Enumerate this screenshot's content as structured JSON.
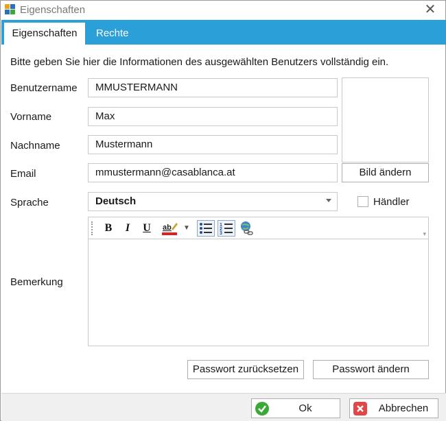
{
  "window": {
    "title": "Eigenschaften",
    "close_glyph": "✕"
  },
  "tabs": [
    {
      "label": "Eigenschaften",
      "active": true
    },
    {
      "label": "Rechte",
      "active": false
    }
  ],
  "form": {
    "instruction": "Bitte geben Sie hier die Informationen des ausgewählten Benutzers vollständig ein.",
    "username_label": "Benutzername",
    "username_value": "MMUSTERMANN",
    "firstname_label": "Vorname",
    "firstname_value": "Max",
    "lastname_label": "Nachname",
    "lastname_value": "Mustermann",
    "email_label": "Email",
    "email_value": "mmustermann@casablanca.at",
    "language_label": "Sprache",
    "language_value": "Deutsch",
    "dealer_label": "Händler",
    "dealer_checked": false,
    "remark_label": "Bemerkung",
    "remark_value": ""
  },
  "photo": {
    "change_label": "Bild ändern"
  },
  "editor_toolbar": {
    "bold": "B",
    "italic": "I",
    "underline": "U",
    "highlight_text": "ab",
    "highlight_color": "#e02020",
    "icons": [
      "bold-icon",
      "italic-icon",
      "underline-icon",
      "highlight-color-icon",
      "bullet-list-icon",
      "numbered-list-icon",
      "insert-link-icon"
    ]
  },
  "buttons": {
    "reset_password": "Passwort zurücksetzen",
    "change_password": "Passwort ändern",
    "ok": "Ok",
    "cancel": "Abbrechen"
  },
  "colors": {
    "tab_bar": "#2b9fd8",
    "ok_icon": "#3aa935",
    "cancel_icon": "#e04848"
  }
}
